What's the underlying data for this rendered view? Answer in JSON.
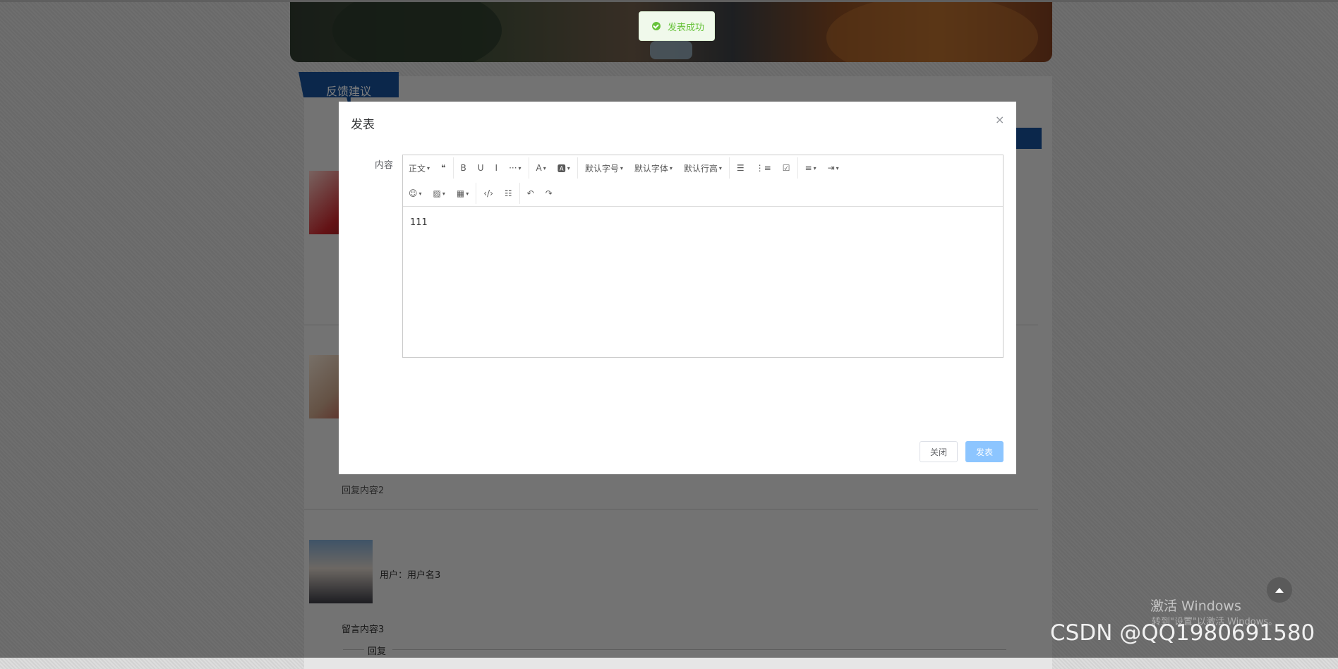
{
  "page": {
    "feedback_tab": "反馈建议",
    "reply_content_2": "回复内容2",
    "user_3": "用户：用户名3",
    "message_3": "留言内容3",
    "reply_label": "回复"
  },
  "toast": {
    "message": "发表成功",
    "color": "#67c23a"
  },
  "dialog": {
    "title": "发表",
    "close_icon": "×",
    "content_label": "内容",
    "editor_text": "111",
    "toolbar_row1": [
      {
        "label": "正文",
        "dropdown": true
      },
      {
        "label": "❝",
        "dropdown": false
      },
      {
        "label": "B",
        "dropdown": false
      },
      {
        "label": "U",
        "dropdown": false
      },
      {
        "label": "I",
        "dropdown": false
      },
      {
        "label": "···",
        "dropdown": true
      },
      {
        "label": "A",
        "dropdown": true
      },
      {
        "label": "🅰",
        "dropdown": true
      },
      {
        "label": "默认字号",
        "dropdown": true
      },
      {
        "label": "默认字体",
        "dropdown": true
      },
      {
        "label": "默认行高",
        "dropdown": true
      },
      {
        "label": "☰",
        "dropdown": false
      },
      {
        "label": "⋮≡",
        "dropdown": false
      },
      {
        "label": "☑",
        "dropdown": false
      },
      {
        "label": "≡",
        "dropdown": true
      },
      {
        "label": "⇥",
        "dropdown": true
      }
    ],
    "toolbar_row2": [
      {
        "label": "☺",
        "dropdown": true
      },
      {
        "label": "▨",
        "dropdown": true
      },
      {
        "label": "▦",
        "dropdown": true
      },
      {
        "label": "‹/›",
        "dropdown": false
      },
      {
        "label": "☷",
        "dropdown": false
      },
      {
        "label": "↶",
        "dropdown": false
      },
      {
        "label": "↷",
        "dropdown": false
      }
    ],
    "close_button": "关闭",
    "submit_button": "发表",
    "submit_color": "#8cc5ff"
  },
  "overlay": {
    "activate_windows": "激活 Windows",
    "activate_sub": "转到\"设置\"以激活 Windows。",
    "watermark": "CSDN @QQ1980691580"
  }
}
